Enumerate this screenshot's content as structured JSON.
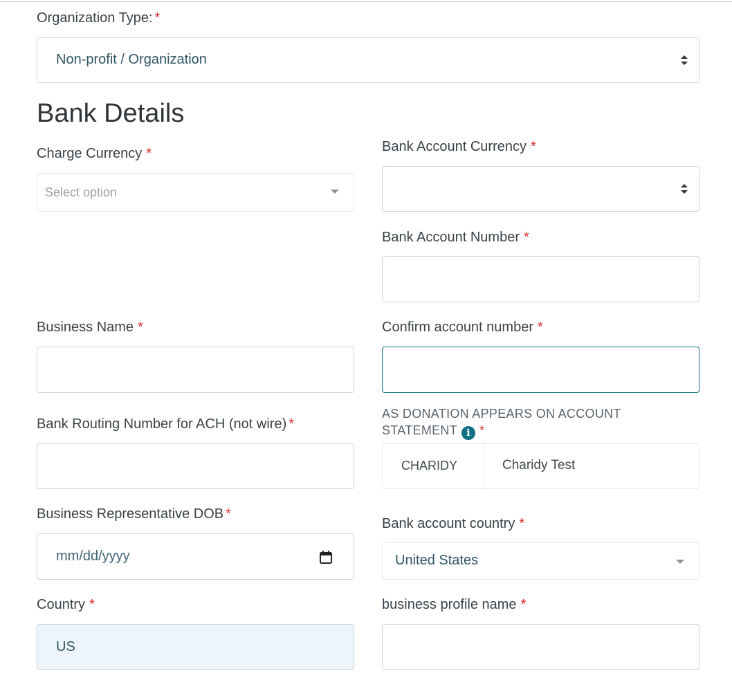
{
  "org": {
    "label": "Organization Type:",
    "required": "*",
    "value": "Non-profit / Organization"
  },
  "bank": {
    "heading": "Bank Details",
    "charge_currency": {
      "label": "Charge Currency",
      "required": "*",
      "placeholder": "Select option"
    },
    "account_currency": {
      "label": "Bank Account Currency",
      "required": "*",
      "value": ""
    },
    "account_number": {
      "label": "Bank Account Number",
      "required": "*",
      "value": ""
    },
    "business_name": {
      "label": "Business Name",
      "required": "*",
      "value": ""
    },
    "confirm_account": {
      "label": "Confirm account number",
      "required": "*",
      "value": ""
    },
    "routing": {
      "label": "Bank Routing Number for ACH (not wire)",
      "required": "*",
      "value": ""
    },
    "descriptor": {
      "label_line1": "AS DONATION APPEARS ON ACCOUNT",
      "label_line2": "STATEMENT",
      "info_icon": "i",
      "required": "*",
      "prefix": "CHARIDY",
      "value": "Charidy Test"
    },
    "dob": {
      "label": "Business Representative DOB",
      "required": "*",
      "placeholder": "mm/dd/yyyy"
    },
    "bank_country": {
      "label": "Bank account country",
      "required": "*",
      "value": "United States"
    },
    "country": {
      "label": "Country",
      "required": "*",
      "value": "US"
    },
    "profile_name": {
      "label": "business profile name",
      "required": "*",
      "value": ""
    }
  },
  "colors": {
    "accent": "#0f6f86",
    "required": "#e02b27",
    "border": "#cfd4d8",
    "filled_bg": "#eef5fa"
  }
}
